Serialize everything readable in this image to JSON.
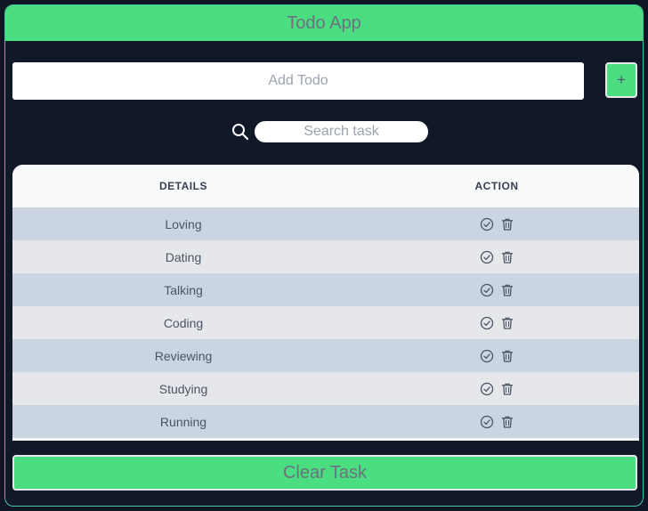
{
  "app": {
    "title": "Todo App"
  },
  "add": {
    "placeholder": "Add Todo",
    "button_label": "+"
  },
  "search": {
    "placeholder": "Search task",
    "icon": "search-icon"
  },
  "table": {
    "columns": [
      "DETAILS",
      "ACTION"
    ],
    "rows": [
      {
        "details": "Loving"
      },
      {
        "details": "Dating"
      },
      {
        "details": "Talking"
      },
      {
        "details": "Coding"
      },
      {
        "details": "Reviewing"
      },
      {
        "details": "Studying"
      },
      {
        "details": "Running"
      }
    ],
    "row_action_icons": [
      "check-circle-icon",
      "trash-icon"
    ]
  },
  "footer": {
    "clear_label": "Clear Task"
  },
  "colors": {
    "accent": "#4ade80",
    "background": "#111827",
    "row_odd": "#cbd5e1",
    "row_even": "#e5e7eb"
  }
}
